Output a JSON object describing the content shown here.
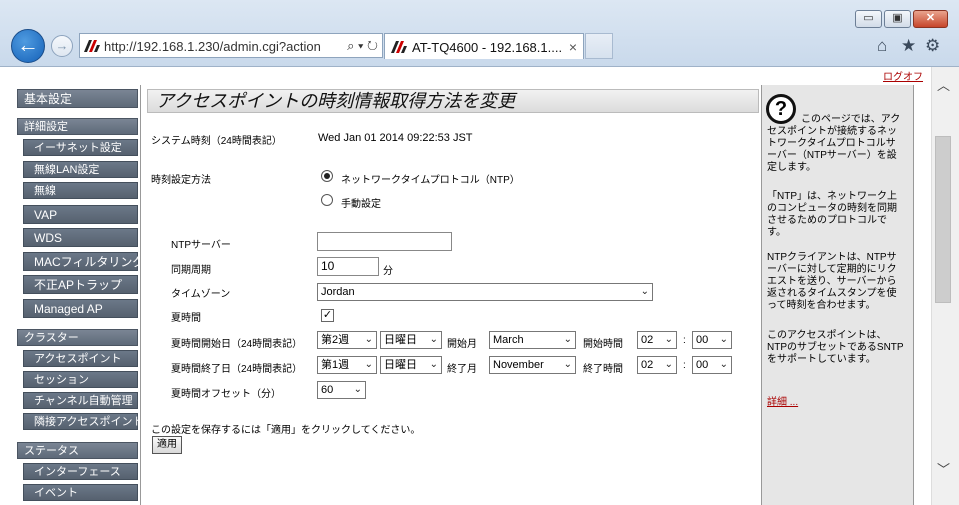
{
  "browser": {
    "url": "http://192.168.1.230/admin.cgi?action",
    "tab_title": "AT-TQ4600 - 192.168.1....",
    "addr_tools": "⌕ ▾ ↻",
    "tab_close": "×",
    "minimize": "▭",
    "maximize": "▣",
    "close": "✕",
    "back": "←",
    "forward": "→",
    "home_icon": "⌂",
    "star_icon": "★",
    "gear_icon": "⚙"
  },
  "logout": "ログオフ",
  "sidebar": {
    "basic": "基本設定",
    "advanced": "詳細設定",
    "ethernet": "イーサネット設定",
    "wlan": "無線LAN設定",
    "wireless": "無線",
    "vap": "VAP",
    "wds": "WDS",
    "mac_filter": "MACフィルタリング",
    "rogue_ap": "不正APトラップ",
    "managed_ap": "Managed AP",
    "cluster": "クラスター",
    "access_points": "アクセスポイント",
    "sessions": "セッション",
    "channel": "チャンネル自動管理",
    "neighbors": "隣接アクセスポイント",
    "status": "ステータス",
    "interfaces": "インターフェース",
    "events": "イベント"
  },
  "main": {
    "title": "アクセスポイントの時刻情報取得方法を変更",
    "system_time_label": "システム時刻（24時間表記）",
    "system_time_value": "Wed Jan 01 2014 09:22:53 JST",
    "method_label": "時刻設定方法",
    "radio_ntp": "ネットワークタイムプロトコル（NTP）",
    "radio_manual": "手動設定",
    "ntp_server_label": "NTPサーバー",
    "ntp_server_value": "",
    "sync_label": "同期周期",
    "sync_value": "10",
    "sync_unit": "分",
    "timezone_label": "タイムゾーン",
    "timezone_value": "Jordan",
    "dst_label": "夏時間",
    "dst_checked": "✓",
    "dst_start_label": "夏時間開始日（24時間表記）",
    "dst_start_week": "第2週",
    "dst_start_day": "日曜日",
    "start_month_label": "開始月",
    "start_month": "March",
    "start_time_label": "開始時間",
    "start_hour": "02",
    "start_min": "00",
    "dst_end_label": "夏時間終了日（24時間表記）",
    "dst_end_week": "第1週",
    "dst_end_day": "日曜日",
    "end_month_label": "終了月",
    "end_month": "November",
    "end_time_label": "終了時間",
    "end_hour": "02",
    "end_min": "00",
    "colon": ":",
    "offset_label": "夏時間オフセット（分）",
    "offset_value": "60",
    "save_note": "この設定を保存するには「適用」をクリックしてください。",
    "apply": "適用"
  },
  "help": {
    "q_mark": "?",
    "p1": "このページでは、アクセスポイントが接続するネットワークタイムプロトコルサーバー（NTPサーバー）を設定します。",
    "p2": "「NTP」は、ネットワーク上のコンピュータの時刻を同期させるためのプロトコルです。",
    "p3": "NTPクライアントは、NTPサーバーに対して定期的にリクエストを送り、サーバーから返されるタイムスタンプを使って時刻を合わせます。",
    "p4": "このアクセスポイントは、NTPのサブセットであるSNTPをサポートしています。",
    "more": "詳細 ..."
  },
  "colors": {
    "sidebar": "#5e6a79",
    "link": "#aa0000",
    "help_bg": "#e6e6e6"
  }
}
